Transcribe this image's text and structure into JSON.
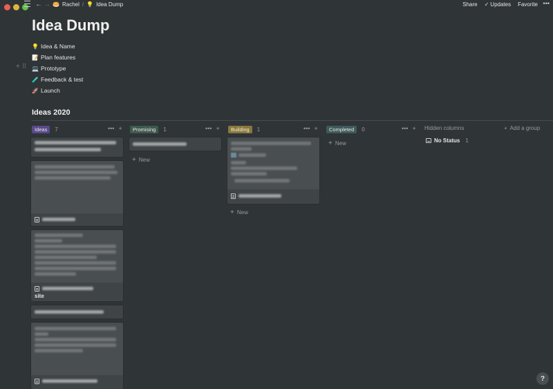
{
  "breadcrumb": {
    "workspace": "Rachel",
    "workspace_icon": "🥯",
    "page": "Idea Dump",
    "page_icon": "💡",
    "separator": "/"
  },
  "top_actions": {
    "share": "Share",
    "updates": "Updates",
    "favorite": "Favorite",
    "more": "•••"
  },
  "page": {
    "title": "Idea Dump"
  },
  "steps": [
    {
      "icon": "💡",
      "label": "Idea & Name"
    },
    {
      "icon": "📝",
      "label": "Plan features"
    },
    {
      "icon": "💻",
      "label": "Prototype"
    },
    {
      "icon": "🧪",
      "label": "Feedback & test"
    },
    {
      "icon": "🚀",
      "label": "Launch"
    }
  ],
  "board": {
    "title": "Ideas 2020",
    "columns": [
      {
        "label": "Ideas",
        "count": "7",
        "color": "#5a4a8c"
      },
      {
        "label": "Promising",
        "count": "1",
        "color": "#3f5a4f"
      },
      {
        "label": "Building",
        "count": "1",
        "color": "#89773f"
      },
      {
        "label": "Completed",
        "count": "0",
        "color": "#3f5a5a"
      }
    ],
    "column_more": "•••",
    "column_add": "+",
    "new_label": "New",
    "hidden_columns_label": "Hidden columns",
    "add_group_label": "Add a group",
    "no_status": {
      "label": "No Status",
      "count": "1"
    },
    "visible_card_text": {
      "ideas_card_3_title_end": "site"
    }
  },
  "help": "?"
}
